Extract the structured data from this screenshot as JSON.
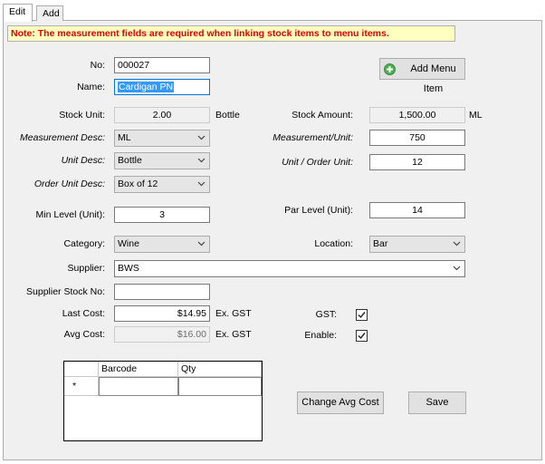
{
  "tabs": [
    {
      "label": "Edit",
      "active": true
    },
    {
      "label": "Add",
      "active": false
    }
  ],
  "note": "Note: The measurement fields are required when linking stock items to menu items.",
  "form": {
    "no_label": "No:",
    "no_value": "000027",
    "name_label": "Name:",
    "name_value": "Cardigan PN",
    "stock_unit_label": "Stock Unit:",
    "stock_unit_value": "2.00",
    "stock_unit_suffix": "Bottle",
    "stock_amount_label": "Stock Amount:",
    "stock_amount_value": "1,500.00",
    "stock_amount_suffix": "ML",
    "measurement_desc_label": "Measurement Desc:",
    "measurement_desc_value": "ML",
    "measurement_unit_label": "Measurement/Unit:",
    "measurement_unit_value": "750",
    "unit_desc_label": "Unit Desc:",
    "unit_desc_value": "Bottle",
    "unit_order_unit_label": "Unit / Order Unit:",
    "unit_order_unit_value": "12",
    "order_unit_desc_label": "Order Unit Desc:",
    "order_unit_desc_value": "Box of 12",
    "min_level_label": "Min Level (Unit):",
    "min_level_value": "3",
    "par_level_label": "Par Level (Unit):",
    "par_level_value": "14",
    "category_label": "Category:",
    "category_value": "Wine",
    "location_label": "Location:",
    "location_value": "Bar",
    "supplier_label": "Supplier:",
    "supplier_value": "BWS",
    "supplier_stock_no_label": "Supplier Stock No:",
    "supplier_stock_no_value": "",
    "last_cost_label": "Last Cost:",
    "last_cost_value": "$14.95",
    "last_cost_suffix": "Ex. GST",
    "avg_cost_label": "Avg Cost:",
    "avg_cost_value": "$16.00",
    "avg_cost_suffix": "Ex. GST",
    "gst_label": "GST:",
    "gst_checked": true,
    "enable_label": "Enable:",
    "enable_checked": true
  },
  "buttons": {
    "add_menu_item": "Add Menu Item",
    "change_avg_cost": "Change Avg Cost",
    "save": "Save"
  },
  "barcode_grid": {
    "columns": [
      "Barcode",
      "Qty"
    ],
    "new_row_marker": "*"
  },
  "colors": {
    "note_bg": "#ffffc0",
    "note_text": "#e00000",
    "selection": "#3399ff",
    "add_icon": "#4caf50"
  }
}
